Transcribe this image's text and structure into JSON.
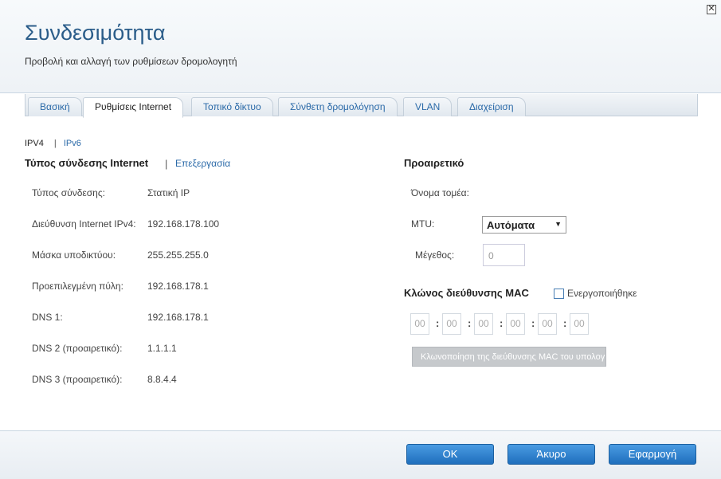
{
  "header": {
    "title": "Συνδεσιμότητα",
    "subtitle": "Προβολή και αλλαγή των ρυθμίσεων δρομολογητή",
    "close_glyph": "✕"
  },
  "tabs": [
    {
      "label": "Βασική"
    },
    {
      "label": "Ρυθμίσεις Internet",
      "active": true
    },
    {
      "label": "Τοπικό δίκτυο"
    },
    {
      "label": "Σύνθετη δρομολόγηση"
    },
    {
      "label": "VLAN"
    },
    {
      "label": "Διαχείριση"
    }
  ],
  "subtabs": {
    "ipv4": "IPV4",
    "separator": "|",
    "ipv6": "IPv6"
  },
  "connection": {
    "title": "Τύπος σύνδεσης Internet",
    "separator": "|",
    "edit_label": "Επεξεργασία",
    "rows": [
      {
        "label": "Τύπος σύνδεσης:",
        "value": "Στατική IP"
      },
      {
        "label": "Διεύθυνση Internet IPv4:",
        "value": "192.168.178.100"
      },
      {
        "label": "Μάσκα υποδικτύου:",
        "value": "255.255.255.0"
      },
      {
        "label": "Προεπιλεγμένη πύλη:",
        "value": "192.168.178.1"
      },
      {
        "label": "DNS 1:",
        "value": "192.168.178.1"
      },
      {
        "label": "DNS 2 (προαιρετικό):",
        "value": "1.1.1.1"
      },
      {
        "label": "DNS 3 (προαιρετικό):",
        "value": "8.8.4.4"
      }
    ]
  },
  "optional": {
    "title": "Προαιρετικό",
    "domain_label": "Όνομα τομέα:",
    "mtu_label": "MTU:",
    "mtu_value": "Αυτόματα",
    "mtu_caret": "▼",
    "size_label": "Μέγεθος:",
    "size_value": "0"
  },
  "mac": {
    "title": "Κλώνος διεύθυνσης MAC",
    "enabled_label": "Ενεργοποιήθηκε",
    "octets": [
      "00",
      "00",
      "00",
      "00",
      "00",
      "00"
    ],
    "colon": ":",
    "clone_button": "Κλωνοποίηση της διεύθυνσης MAC του υπολογιστή μου"
  },
  "footer": {
    "ok": "OK",
    "cancel": "Άκυρο",
    "apply": "Εφαρμογή"
  }
}
